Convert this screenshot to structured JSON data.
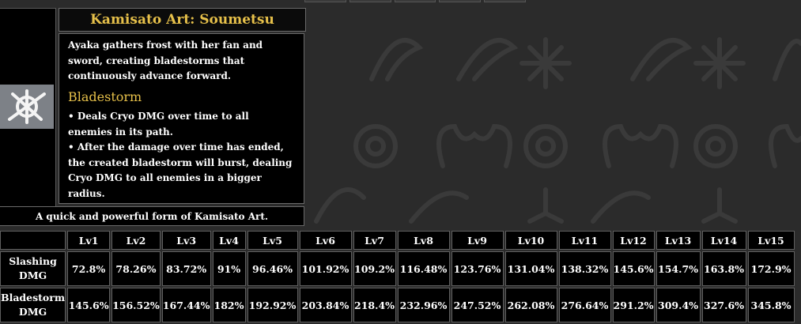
{
  "skill": {
    "title": "Kamisato Art: Soumetsu",
    "description": "Ayaka gathers frost with her fan and sword, creating bladestorms that continuously advance forward.",
    "subheading": "Bladestorm",
    "bullets": [
      "• Deals Cryo DMG over time to all enemies in its path.",
      "• After the damage over time has ended, the created bladestorm will burst, dealing Cryo DMG to all enemies in a bigger radius."
    ],
    "summary": "A quick and powerful form of Kamisato Art.",
    "icon": "burst-slash-icon"
  },
  "table": {
    "levels": [
      "Lv1",
      "Lv2",
      "Lv3",
      "Lv4",
      "Lv5",
      "Lv6",
      "Lv7",
      "Lv8",
      "Lv9",
      "Lv10",
      "Lv11",
      "Lv12",
      "Lv13",
      "Lv14",
      "Lv15"
    ],
    "rows": [
      {
        "label_line1": "Slashing",
        "label_line2": "DMG",
        "values": [
          "72.8%",
          "78.26%",
          "83.72%",
          "91%",
          "96.46%",
          "101.92%",
          "109.2%",
          "116.48%",
          "123.76%",
          "131.04%",
          "138.32%",
          "145.6%",
          "154.7%",
          "163.8%",
          "172.9%"
        ]
      },
      {
        "label_line1": "Bladestorm",
        "label_line2": "DMG",
        "values": [
          "145.6%",
          "156.52%",
          "167.44%",
          "182%",
          "192.92%",
          "203.84%",
          "218.4%",
          "232.96%",
          "247.52%",
          "262.08%",
          "276.64%",
          "291.2%",
          "309.4%",
          "327.6%",
          "345.8%"
        ]
      }
    ]
  }
}
